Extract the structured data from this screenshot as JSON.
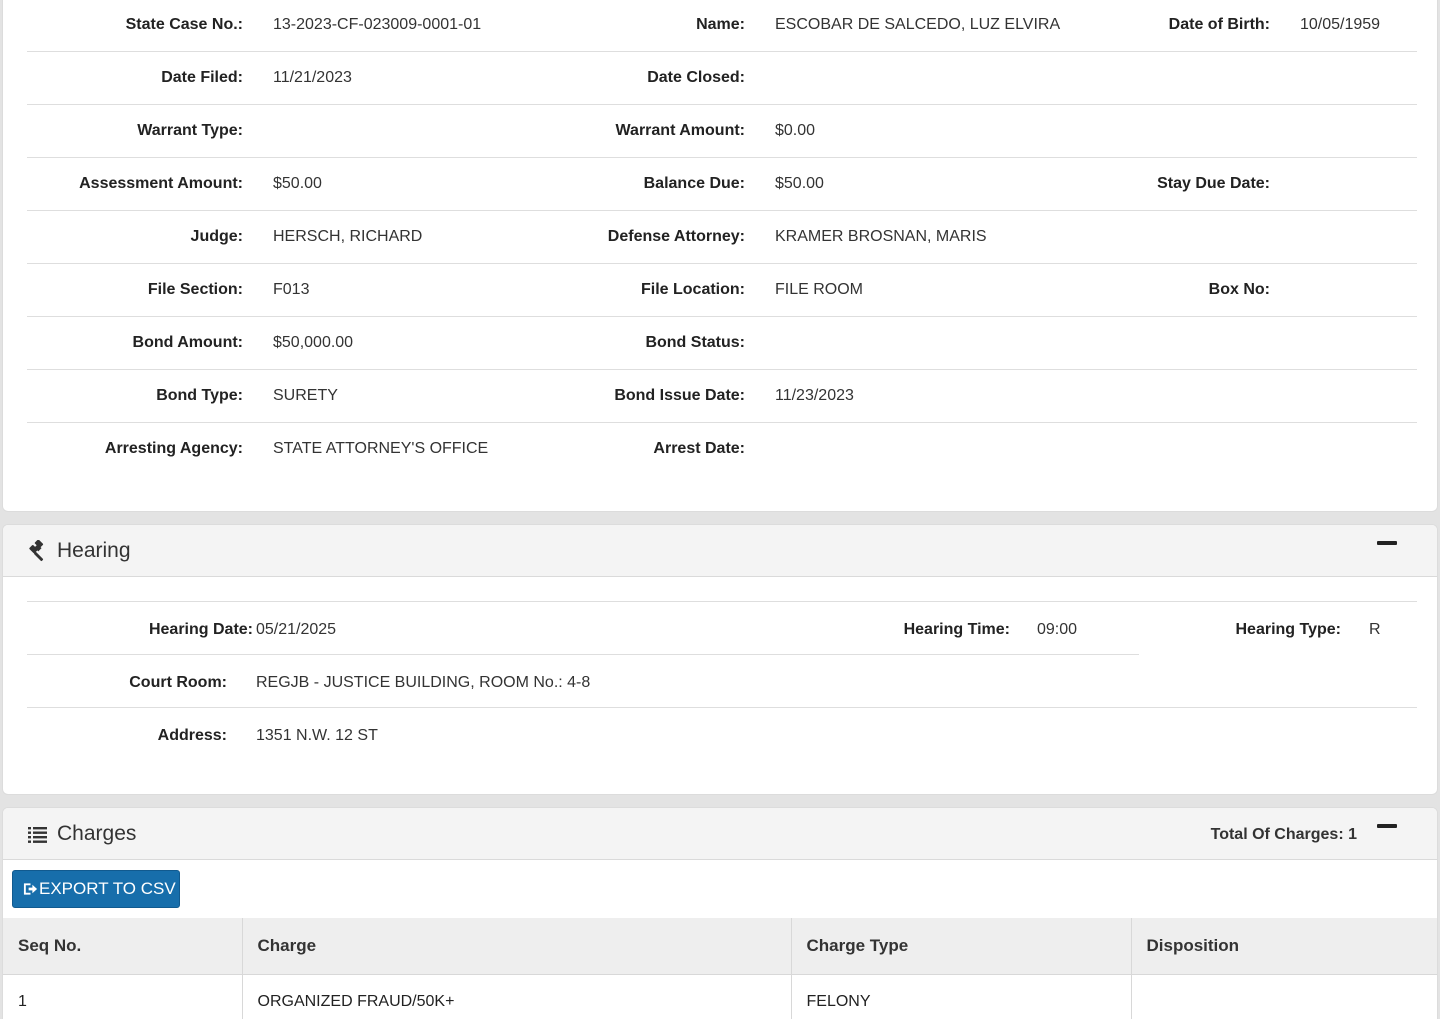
{
  "case": {
    "rows": [
      [
        {
          "label": "State Case No.:",
          "value": "13-2023-CF-023009-0001-01"
        },
        {
          "label": "Name:",
          "value": "ESCOBAR DE SALCEDO, LUZ ELVIRA"
        },
        {
          "label": "Date of Birth:",
          "value": "10/05/1959"
        }
      ],
      [
        {
          "label": "Date Filed:",
          "value": "11/21/2023"
        },
        {
          "label": "Date Closed:",
          "value": ""
        },
        {
          "label": "",
          "value": ""
        }
      ],
      [
        {
          "label": "Warrant Type:",
          "value": ""
        },
        {
          "label": "Warrant Amount:",
          "value": "$0.00"
        },
        {
          "label": "",
          "value": ""
        }
      ],
      [
        {
          "label": "Assessment Amount:",
          "value": "$50.00"
        },
        {
          "label": "Balance Due:",
          "value": "$50.00"
        },
        {
          "label": "Stay Due Date:",
          "value": ""
        }
      ],
      [
        {
          "label": "Judge:",
          "value": "HERSCH, RICHARD"
        },
        {
          "label": "Defense Attorney:",
          "value": "KRAMER BROSNAN, MARIS"
        },
        {
          "label": "",
          "value": ""
        }
      ],
      [
        {
          "label": "File Section:",
          "value": "F013"
        },
        {
          "label": "File Location:",
          "value": "FILE ROOM"
        },
        {
          "label": "Box No:",
          "value": ""
        }
      ],
      [
        {
          "label": "Bond Amount:",
          "value": "$50,000.00"
        },
        {
          "label": "Bond Status:",
          "value": ""
        },
        {
          "label": "",
          "value": ""
        }
      ],
      [
        {
          "label": "Bond Type:",
          "value": "SURETY"
        },
        {
          "label": "Bond Issue Date:",
          "value": "11/23/2023"
        },
        {
          "label": "",
          "value": ""
        }
      ],
      [
        {
          "label": "Arresting Agency:",
          "value": "STATE ATTORNEY'S OFFICE"
        },
        {
          "label": "Arrest Date:",
          "value": ""
        },
        {
          "label": "",
          "value": ""
        }
      ]
    ]
  },
  "hearing": {
    "title": "Hearing",
    "icon": "gavel-icon",
    "date_label": "Hearing Date:",
    "date_value": "05/21/2025",
    "time_label": "Hearing Time:",
    "time_value": "09:00",
    "type_label": "Hearing Type:",
    "type_value": "R",
    "room_label": "Court Room:",
    "room_value": "REGJB - JUSTICE BUILDING, ROOM No.: 4-8",
    "address_label": "Address:",
    "address_value": "1351 N.W. 12 ST"
  },
  "charges": {
    "title": "Charges",
    "icon": "list-icon",
    "total_label": "Total Of Charges: 1",
    "export_label": "EXPORT TO CSV",
    "columns": [
      "Seq No.",
      "Charge",
      "Charge Type",
      "Disposition"
    ],
    "rows": [
      [
        "1",
        "ORGANIZED FRAUD/50K+",
        "FELONY",
        ""
      ]
    ]
  },
  "colors": {
    "accent": "#176eab",
    "header_bg": "#f4f4f4"
  }
}
